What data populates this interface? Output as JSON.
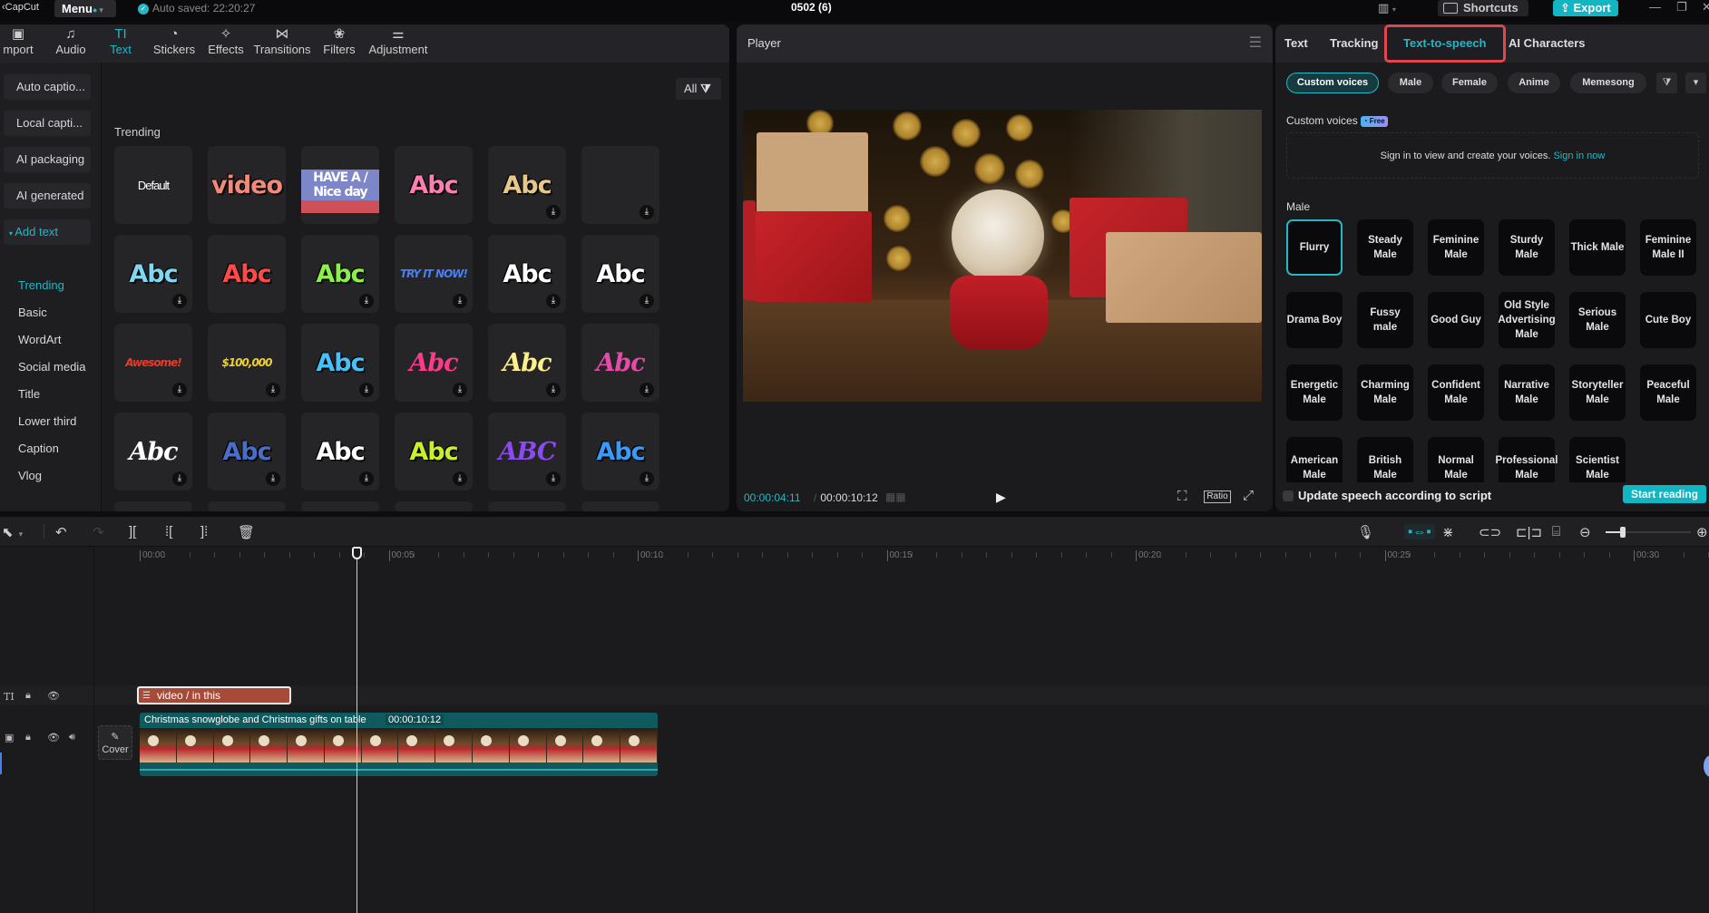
{
  "titlebar": {
    "app_name": "CapCut",
    "menu_label": "Menu",
    "autosave": "Auto saved: 22:20:27",
    "project_title": "0502 (6)",
    "shortcuts_label": "Shortcuts",
    "export_label": "Export",
    "window_controls": {
      "minimize": "—",
      "restore": "❐",
      "close": "✕"
    }
  },
  "toolbar": {
    "items": [
      {
        "label": "mport",
        "icon": "import-icon",
        "glyph": "▣"
      },
      {
        "label": "Audio",
        "icon": "audio-icon",
        "glyph": "♫"
      },
      {
        "label": "Text",
        "icon": "text-icon",
        "glyph": "TI",
        "active": true
      },
      {
        "label": "Stickers",
        "icon": "stickers-icon",
        "glyph": "◔"
      },
      {
        "label": "Effects",
        "icon": "effects-icon",
        "glyph": "✧"
      },
      {
        "label": "Transitions",
        "icon": "transitions-icon",
        "glyph": "⋈"
      },
      {
        "label": "Filters",
        "icon": "filters-icon",
        "glyph": "❀"
      },
      {
        "label": "Adjustment",
        "icon": "adjustment-icon",
        "glyph": "⚌"
      }
    ]
  },
  "sidebar": {
    "buttons": [
      "Auto captio...",
      "Local capti...",
      "AI packaging",
      "AI generated"
    ],
    "group": "Add text",
    "subitems": [
      "Trending",
      "Basic",
      "WordArt",
      "Social media",
      "Title",
      "Lower third",
      "Caption",
      "Vlog"
    ],
    "active_subitem": "Trending"
  },
  "text_library": {
    "filter_label": "All",
    "section": "Trending",
    "rows": [
      [
        {
          "text": "Default",
          "color": "#ffffff",
          "download": false,
          "kind": "plain"
        },
        {
          "text": "video",
          "color": "#f08a7a",
          "download": false
        },
        {
          "text": "HAVE A / Nice day",
          "color": "#ffffff",
          "download": false,
          "kind": "banner"
        },
        {
          "text": "Abc",
          "color": "#ff7fb0",
          "download": false
        },
        {
          "text": "Abc",
          "color": "#e6c98a",
          "download": true
        },
        {
          "text": "",
          "color": "#ffffff",
          "download": true
        }
      ],
      [
        {
          "text": "Abc",
          "color": "#7fd8f0",
          "download": true
        },
        {
          "text": "Abc",
          "color": "#ff4a4a",
          "download": false
        },
        {
          "text": "Abc",
          "color": "#8cf04a",
          "download": true
        },
        {
          "text": "TRY IT NOW!",
          "color": "#4a7ef2",
          "download": true,
          "kind": "small"
        },
        {
          "text": "Abc",
          "color": "#ffffff",
          "download": true
        },
        {
          "text": "Abc",
          "color": "#ffffff",
          "download": true
        }
      ],
      [
        {
          "text": "Awesome!",
          "color": "#e83a2a",
          "download": true,
          "kind": "small"
        },
        {
          "text": "$100,000",
          "color": "#f0d030",
          "download": true,
          "kind": "small"
        },
        {
          "text": "Abc",
          "color": "#4ac0f8",
          "download": true
        },
        {
          "text": "Abc",
          "color": "#ff3a8a",
          "download": true,
          "kind": "script"
        },
        {
          "text": "Abc",
          "color": "#fff08a",
          "download": true,
          "kind": "script"
        },
        {
          "text": "Abc",
          "color": "#e84aa8",
          "download": true,
          "kind": "script"
        }
      ],
      [
        {
          "text": "Abc",
          "color": "#ffffff",
          "download": true,
          "kind": "script"
        },
        {
          "text": "Abc",
          "color": "#4a6ec8",
          "download": true
        },
        {
          "text": "Abc",
          "color": "#ffffff",
          "download": true
        },
        {
          "text": "Abc",
          "color": "#c8f030",
          "download": true
        },
        {
          "text": "ABC",
          "color": "#8a4af0",
          "download": true,
          "kind": "script"
        },
        {
          "text": "Abc",
          "color": "#3a9af8",
          "download": true
        }
      ]
    ]
  },
  "player": {
    "title": "Player",
    "current_time": "00:00:04:11",
    "duration": "00:00:10:12",
    "ratio_label": "Ratio"
  },
  "right_panel": {
    "tabs": [
      "Text",
      "Tracking",
      "Text-to-speech",
      "AI Characters"
    ],
    "active_tab": "Text-to-speech",
    "chips": [
      "Custom voices",
      "Male",
      "Female",
      "Anime",
      "Memesong"
    ],
    "active_chip": "Custom voices",
    "custom_voices_title": "Custom voices",
    "free_badge": "Free",
    "signin_text": "Sign in to view and create your voices.",
    "signin_link": "Sign in now",
    "male_title": "Male",
    "voices": [
      "Flurry",
      "Steady Male",
      "Feminine Male",
      "Sturdy Male",
      "Thick Male",
      "Feminine Male II",
      "Drama Boy",
      "Fussy male",
      "Good Guy",
      "Old Style Advertising Male",
      "Serious Male",
      "Cute Boy",
      "Energetic Male",
      "Charming Male",
      "Confident Male",
      "Narrative Male",
      "Storyteller Male",
      "Peaceful Male",
      "American Male",
      "British Male",
      "Normal Male",
      "Professional Male",
      "Scientist Male"
    ],
    "selected_voice": "Flurry",
    "update_speech_label": "Update speech according to script",
    "update_speech_checked": false,
    "start_reading_label": "Start reading"
  },
  "timeline": {
    "ruler_labels": [
      "00:00",
      "00:05",
      "00:10",
      "00:15",
      "00:20",
      "00:25",
      "00:30"
    ],
    "text_clip_label": "video / in this",
    "video_clip_name": "Christmas snowglobe and Christmas gifts on table",
    "video_clip_duration": "00:00:10:12",
    "cover_label": "Cover",
    "zoom_level": 0.2
  },
  "colors": {
    "accent": "#25b7c5",
    "highlight_box": "#e0464b",
    "text_clip": "#a84a38",
    "video_clip": "#0e5a5e"
  }
}
